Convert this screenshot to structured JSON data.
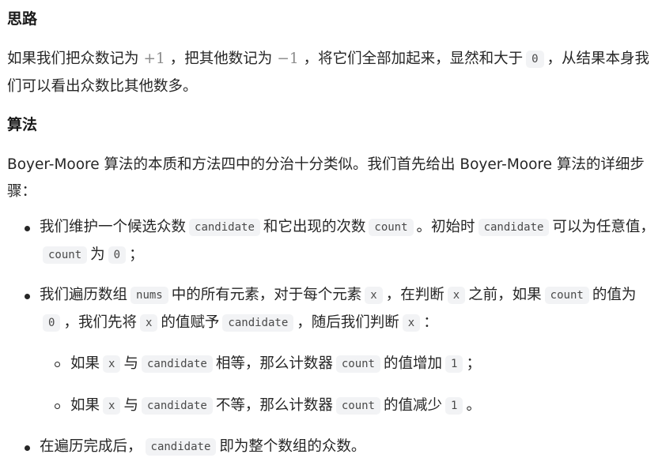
{
  "sections": {
    "siLu": {
      "heading": "思路",
      "intro": {
        "t1": "如果我们把众数记为",
        "plus1": "+1",
        "t2": "，把其他数记为",
        "minus1": "−1",
        "t3": "，将它们全部加起来，显然和大于",
        "zero": "0",
        "t4": "，从结果本身我们可以看出众数比其他数多。"
      }
    },
    "suanFa": {
      "heading": "算法",
      "intro": "Boyer-Moore 算法的本质和方法四中的分治十分类似。我们首先给出 Boyer-Moore 算法的详细步骤："
    }
  },
  "steps": {
    "s1": {
      "t1": "我们维护一个候选众数",
      "c1": "candidate",
      "t2": "和它出现的次数",
      "c2": "count",
      "t3": "。初始时",
      "c3": "candidate",
      "t4": "可以为任意值，",
      "c4": "count",
      "t5": "为",
      "c5": "0",
      "t6": "；"
    },
    "s2": {
      "t1": "我们遍历数组",
      "c1": "nums",
      "t2": "中的所有元素，对于每个元素",
      "c2": "x",
      "t3": "，在判断",
      "c3": "x",
      "t4": "之前，如果",
      "c4": "count",
      "t5": "的值为",
      "c5": "0",
      "t6": "，我们先将",
      "c6": "x",
      "t7": "的值赋予",
      "c7": "candidate",
      "t8": "，随后我们判断",
      "c8": "x",
      "t9": "："
    },
    "s2a": {
      "t1": "如果",
      "c1": "x",
      "t2": "与",
      "c2": "candidate",
      "t3": "相等，那么计数器",
      "c3": "count",
      "t4": "的值增加",
      "c4": "1",
      "t5": "；"
    },
    "s2b": {
      "t1": "如果",
      "c1": "x",
      "t2": "与",
      "c2": "candidate",
      "t3": "不等，那么计数器",
      "c3": "count",
      "t4": "的值减少",
      "c4": "1",
      "t5": "。"
    },
    "s3": {
      "t1": "在遍历完成后，",
      "c1": "candidate",
      "t2": "即为整个数组的众数。"
    }
  }
}
